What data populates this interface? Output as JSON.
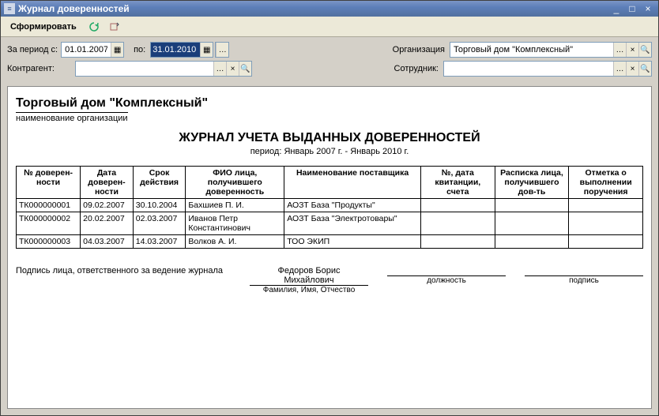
{
  "window": {
    "title": "Журнал доверенностей"
  },
  "toolbar": {
    "form": "Сформировать"
  },
  "filters": {
    "period_label": "За период с:",
    "date_from": "01.01.2007",
    "to_label": "по:",
    "date_to": "31.01.2010",
    "org_label": "Организация",
    "org_value": "Торговый дом \"Комплексный\"",
    "contr_label": "Контрагент:",
    "contr_value": "",
    "emp_label": "Сотрудник:",
    "emp_value": ""
  },
  "report": {
    "org_name": "Торговый дом \"Комплексный\"",
    "org_sub": "наименование организации",
    "title": "ЖУРНАЛ УЧЕТА ВЫДАННЫХ ДОВЕРЕННОСТЕЙ",
    "period": "период: Январь 2007 г. - Январь 2010 г.",
    "headers": {
      "c0": "№ доверен-ности",
      "c1": "Дата доверен-ности",
      "c2": "Срок действия",
      "c3": "ФИО лица, получившего доверенность",
      "c4": "Наименование поставщика",
      "c5": "№, дата квитанции, счета",
      "c6": "Расписка лица, получившего дов-ть",
      "c7": "Отметка о выполнении поручения"
    },
    "rows": [
      {
        "c0": "ТК000000001",
        "c1": "09.02.2007",
        "c2": "30.10.2004",
        "c3": "Бахшиев П. И.",
        "c4": "АОЗТ База \"Продукты\"",
        "c5": "",
        "c6": "",
        "c7": ""
      },
      {
        "c0": "ТК000000002",
        "c1": "20.02.2007",
        "c2": "02.03.2007",
        "c3": "Иванов  Петр Константинович",
        "c4": "АОЗТ База \"Электротовары\"",
        "c5": "",
        "c6": "",
        "c7": ""
      },
      {
        "c0": "ТК000000003",
        "c1": "04.03.2007",
        "c2": "14.03.2007",
        "c3": "Волков А. И.",
        "c4": "ТОО ЭКИП",
        "c5": "",
        "c6": "",
        "c7": ""
      }
    ],
    "sig_left": "Подпись лица, ответственного за ведение журнала",
    "sig_name": "Федоров Борис Михайлович",
    "sig_cap_name": "Фамилия, Имя, Отчество",
    "sig_cap_pos": "должность",
    "sig_cap_sign": "подпись"
  }
}
